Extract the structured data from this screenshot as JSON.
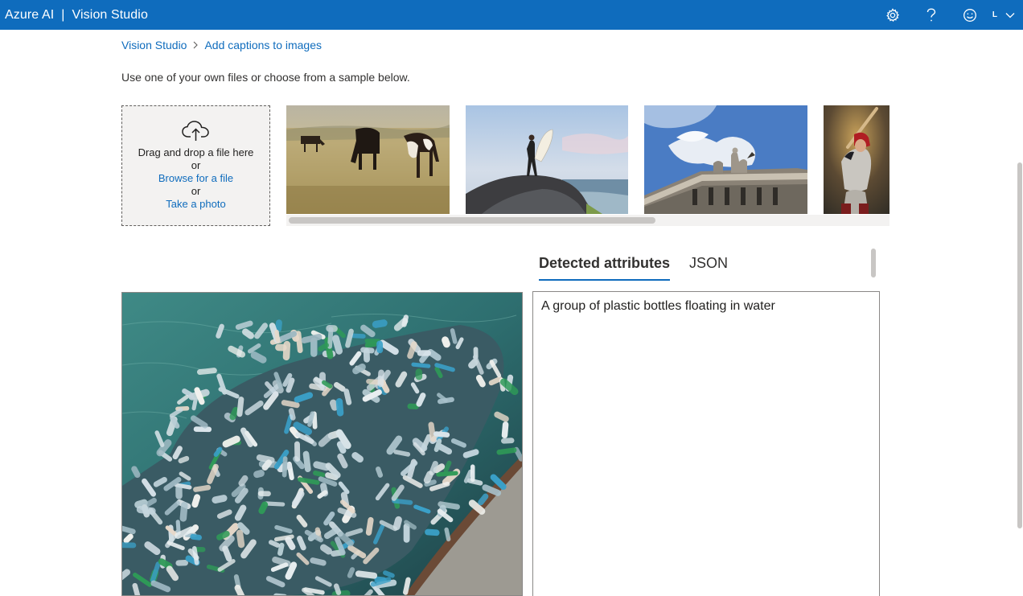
{
  "header": {
    "brand": "Azure AI",
    "separator": "|",
    "product": "Vision Studio",
    "icons": [
      "settings-icon",
      "help-icon",
      "feedback-icon"
    ],
    "account_initial": "L"
  },
  "breadcrumb": {
    "items": [
      "Vision Studio",
      "Add captions to images"
    ]
  },
  "instruction": "Use one of your own files or choose from a sample below.",
  "dropzone": {
    "line1": "Drag and drop a file here",
    "or1": "or",
    "browse": "Browse for a file",
    "or2": "or",
    "photo": "Take a photo"
  },
  "samples": [
    "cows grazing in a field",
    "surfer standing on a rock",
    "statues on a building",
    "baseball batter"
  ],
  "tabs": {
    "items": [
      "Detected attributes",
      "JSON"
    ],
    "active": "Detected attributes"
  },
  "result": {
    "caption": "A group of plastic bottles floating in water"
  },
  "colors": {
    "accent": "#0f6cbd",
    "dropzone_bg": "#f3f2f1"
  }
}
